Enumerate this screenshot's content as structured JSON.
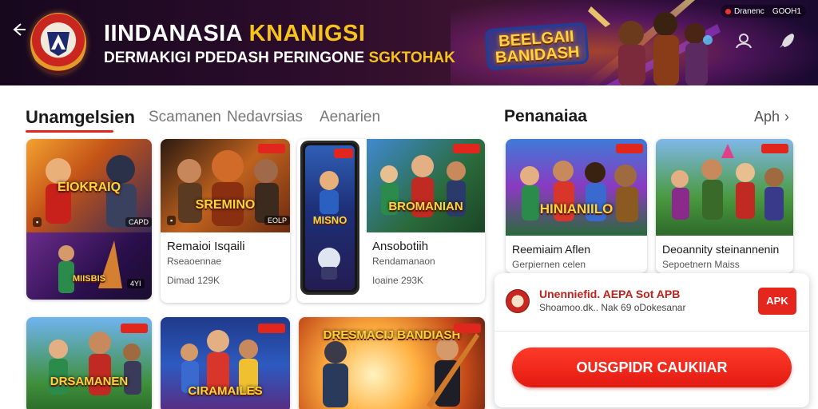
{
  "header": {
    "title_main": "IINDANASIA ",
    "title_accent": "KNANIGSI",
    "subtitle_main": "DERMAKIGI PDEDASH PERINGONE ",
    "subtitle_accent": "SGKTOHAK",
    "hero_logo_text": "BEELGAII BANIDASH",
    "status_left": "Dranenc",
    "status_right": "GOOH1",
    "colors": {
      "accent": "#f6c21c",
      "background": "#2a0c2a"
    }
  },
  "tabs": [
    {
      "label": "Unamgelsien",
      "active": true
    },
    {
      "label": "Scamanen",
      "active": false
    },
    {
      "label": "Nedavrsias",
      "active": false
    },
    {
      "label": "Aenarien",
      "active": false
    }
  ],
  "left_cards": [
    {
      "art_label": "EIOKRAIQ",
      "badge": "",
      "mini": "CAPD"
    },
    {
      "art_label": "MIISBIS",
      "badge": "",
      "mini": "4YI"
    },
    {
      "art_label": "SREMINO",
      "badge": "",
      "mini": "EOLP",
      "title": "Remaioi Isqaili",
      "sub": "Rseaoennae",
      "meta": "Dimad 129K"
    },
    {
      "art_label": "MISNO",
      "badge": ""
    },
    {
      "art_label": "BROMANIAN",
      "badge": "",
      "title": "Ansobotiih",
      "sub": "Rendamanaon",
      "meta": "Ioaine 293K"
    },
    {
      "art_label": "DRSAMANEN",
      "badge": ""
    },
    {
      "art_label": "CIRAMAILES",
      "badge": ""
    },
    {
      "art_label": "DRESMACIJ BANDIASH",
      "badge": ""
    }
  ],
  "right_section": {
    "title": "Penanaiaa",
    "link_label": "Aph",
    "cards": [
      {
        "art_label": "HINIANIILO",
        "title": "Reemiaim Aflen",
        "sub": "Gerpiernen celen"
      },
      {
        "art_label": "",
        "title": "Deoannity steinannenin",
        "sub": "Sepoetnern Maiss"
      }
    ]
  },
  "download": {
    "title": "Unenniefid. AEPA Sot APB",
    "subtitle": "Shoamoo.dk.. Nak 69 oDokesanar",
    "apk_label": "APK",
    "main_button": "OUSGPIDR CAUKIIAR"
  }
}
